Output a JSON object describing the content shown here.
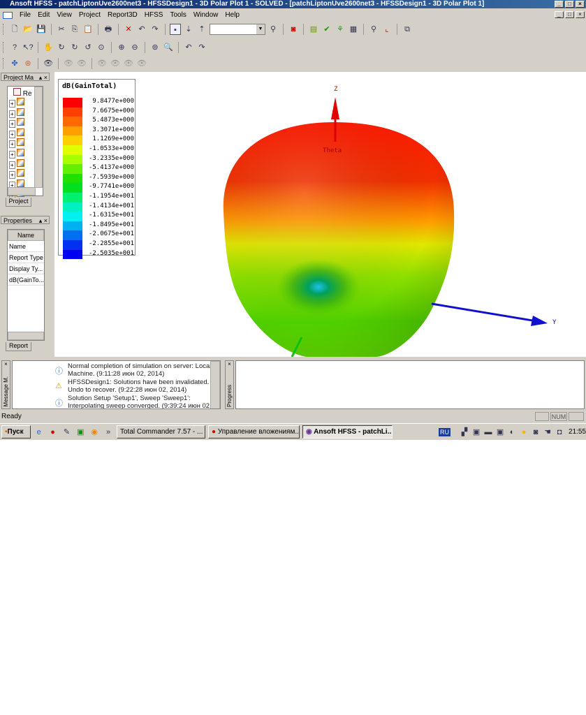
{
  "window": {
    "title": "Ansoft HFSS - patchLiptonUve2600net3 - HFSSDesign1 - 3D Polar Plot 1 - SOLVED - [patchLiptonUve2600net3 - HFSSDesign1 - 3D Polar Plot 1]"
  },
  "menu": [
    "File",
    "Edit",
    "View",
    "Project",
    "Report3D",
    "HFSS",
    "Tools",
    "Window",
    "Help"
  ],
  "project_panel": {
    "title": "Project Ma",
    "root_label": "Re",
    "tab": "Project"
  },
  "properties_panel": {
    "title": "Properties",
    "header": "Name",
    "rows": [
      "Name",
      "Report Type",
      "Display Ty...",
      "dB(GainTo..."
    ],
    "tab": "Report"
  },
  "plot": {
    "legend_title": "dB(GainTotal)",
    "legend": [
      {
        "label": "9.8477e+000",
        "color": "#ff0000"
      },
      {
        "label": "7.6675e+000",
        "color": "#ff4000"
      },
      {
        "label": "5.4873e+000",
        "color": "#ff6a00"
      },
      {
        "label": "3.3071e+000",
        "color": "#ffa000"
      },
      {
        "label": "1.1269e+000",
        "color": "#ffd000"
      },
      {
        "label": "-1.0533e+000",
        "color": "#e0ff00"
      },
      {
        "label": "-3.2335e+000",
        "color": "#a8ff00"
      },
      {
        "label": "-5.4137e+000",
        "color": "#60f000"
      },
      {
        "label": "-7.5939e+000",
        "color": "#20e000"
      },
      {
        "label": "-9.7741e+000",
        "color": "#00e020"
      },
      {
        "label": "-1.1954e+001",
        "color": "#00f070"
      },
      {
        "label": "-1.4134e+001",
        "color": "#00f0c0"
      },
      {
        "label": "-1.6315e+001",
        "color": "#00f0f0"
      },
      {
        "label": "-1.8495e+001",
        "color": "#00b0f0"
      },
      {
        "label": "-2.0675e+001",
        "color": "#0070f0"
      },
      {
        "label": "-2.2855e+001",
        "color": "#0030f0"
      },
      {
        "label": "-2.5035e+001",
        "color": "#0000f0"
      }
    ],
    "axis_z": "Z",
    "axis_y": "Y",
    "theta_label": "Theta"
  },
  "messages": [
    {
      "icon": "info",
      "text1": "Normal completion of simulation on server: Local",
      "text2": "Machine. (9:11:28  июн 02, 2014)"
    },
    {
      "icon": "warning",
      "text1": "HFSSDesign1: Solutions have been invalidated.",
      "text2": "Undo to recover. (9:22:28  июн 02, 2014)"
    },
    {
      "icon": "info",
      "text1": "Solution Setup 'Setup1', Sweep 'Sweep1':",
      "text2": "Interpolating sweep converged. (9:39:24  июн 02"
    }
  ],
  "message_panel_title": "Message M.",
  "progress_panel_title": "Progress",
  "status": {
    "text": "Ready",
    "num": "NUM"
  },
  "taskbar": {
    "start": "Пуск",
    "tasks": [
      "Total Commander 7.57 - ...",
      "Управление вложениям...",
      "Ansoft HFSS - patchLi..."
    ],
    "lang": "RU",
    "clock": "21:55"
  }
}
